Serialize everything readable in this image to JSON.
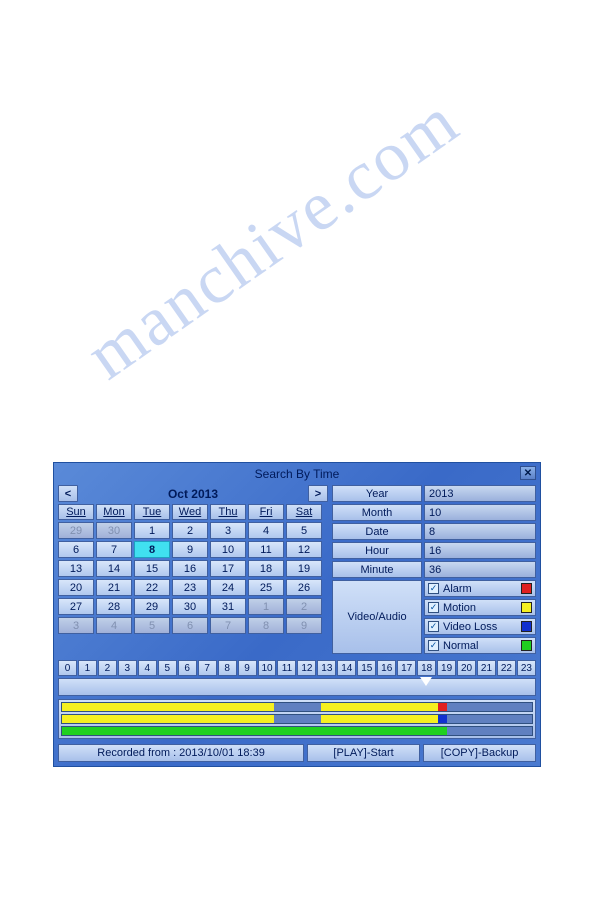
{
  "watermark": "manchive.com",
  "title": "Search By Time",
  "monthNav": {
    "prev": "<",
    "label": "Oct 2013",
    "next": ">"
  },
  "dayHeaders": [
    "Sun",
    "Mon",
    "Tue",
    "Wed",
    "Thu",
    "Fri",
    "Sat"
  ],
  "calendar": [
    [
      {
        "d": "29",
        "dim": true
      },
      {
        "d": "30",
        "dim": true
      },
      {
        "d": "1"
      },
      {
        "d": "2"
      },
      {
        "d": "3"
      },
      {
        "d": "4"
      },
      {
        "d": "5"
      }
    ],
    [
      {
        "d": "6"
      },
      {
        "d": "7"
      },
      {
        "d": "8",
        "sel": true
      },
      {
        "d": "9"
      },
      {
        "d": "10"
      },
      {
        "d": "11"
      },
      {
        "d": "12"
      }
    ],
    [
      {
        "d": "13"
      },
      {
        "d": "14"
      },
      {
        "d": "15"
      },
      {
        "d": "16"
      },
      {
        "d": "17"
      },
      {
        "d": "18"
      },
      {
        "d": "19"
      }
    ],
    [
      {
        "d": "20"
      },
      {
        "d": "21"
      },
      {
        "d": "22"
      },
      {
        "d": "23"
      },
      {
        "d": "24"
      },
      {
        "d": "25"
      },
      {
        "d": "26"
      }
    ],
    [
      {
        "d": "27"
      },
      {
        "d": "28"
      },
      {
        "d": "29"
      },
      {
        "d": "30"
      },
      {
        "d": "31"
      },
      {
        "d": "1",
        "dim": true
      },
      {
        "d": "2",
        "dim": true
      }
    ],
    [
      {
        "d": "3",
        "dim": true
      },
      {
        "d": "4",
        "dim": true
      },
      {
        "d": "5",
        "dim": true
      },
      {
        "d": "6",
        "dim": true
      },
      {
        "d": "7",
        "dim": true
      },
      {
        "d": "8",
        "dim": true
      },
      {
        "d": "9",
        "dim": true
      }
    ]
  ],
  "fields": [
    {
      "label": "Year",
      "value": "2013"
    },
    {
      "label": "Month",
      "value": "10"
    },
    {
      "label": "Date",
      "value": "8"
    },
    {
      "label": "Hour",
      "value": "16"
    },
    {
      "label": "Minute",
      "value": "36"
    }
  ],
  "videoAudioLabel": "Video/Audio",
  "legend": [
    {
      "label": "Alarm",
      "color": "#e02020",
      "checked": true
    },
    {
      "label": "Motion",
      "color": "#f5f020",
      "checked": true
    },
    {
      "label": "Video Loss",
      "color": "#1030d0",
      "checked": true
    },
    {
      "label": "Normal",
      "color": "#20d020",
      "checked": true
    }
  ],
  "hours": [
    "0",
    "1",
    "2",
    "3",
    "4",
    "5",
    "6",
    "7",
    "8",
    "9",
    "10",
    "11",
    "12",
    "13",
    "14",
    "15",
    "16",
    "17",
    "18",
    "19",
    "20",
    "21",
    "22",
    "23"
  ],
  "markerPos": 77,
  "tracks": [
    [
      {
        "start": 0,
        "end": 45,
        "c": "#f5f020"
      },
      {
        "start": 55,
        "end": 80,
        "c": "#f5f020"
      },
      {
        "start": 80,
        "end": 82,
        "c": "#e02020"
      }
    ],
    [
      {
        "start": 0,
        "end": 45,
        "c": "#f5f020"
      },
      {
        "start": 55,
        "end": 80,
        "c": "#f5f020"
      },
      {
        "start": 80,
        "end": 82,
        "c": "#1030d0"
      }
    ],
    [
      {
        "start": 0,
        "end": 82,
        "c": "#20d020"
      }
    ]
  ],
  "status": "Recorded from : 2013/10/01 18:39",
  "actions": {
    "play": "[PLAY]-Start",
    "copy": "[COPY]-Backup"
  }
}
